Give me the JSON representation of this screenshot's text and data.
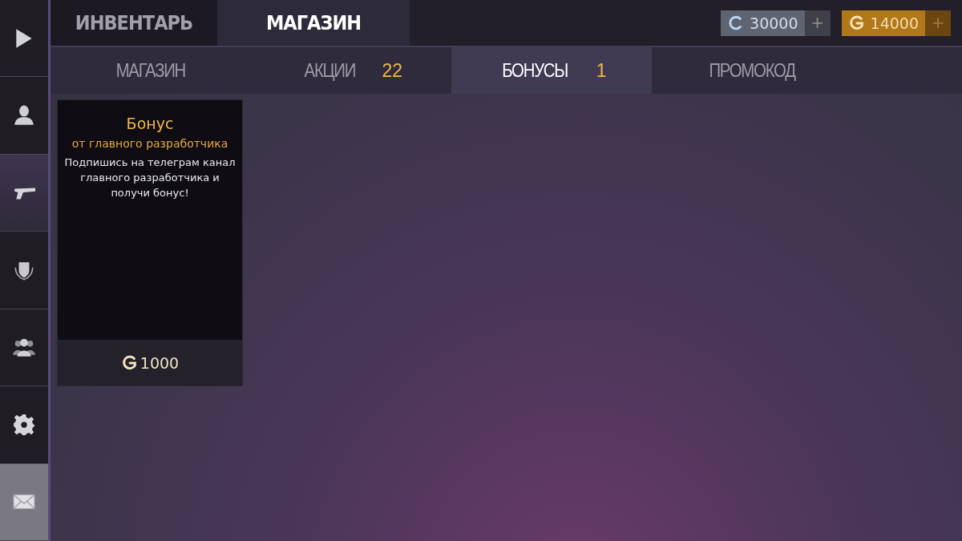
{
  "sidebar": {
    "items": [
      {
        "kind": "play",
        "selected": false
      },
      {
        "kind": "profile",
        "selected": false
      },
      {
        "kind": "pistol",
        "selected": true
      },
      {
        "kind": "shield",
        "selected": false
      },
      {
        "kind": "people",
        "selected": false
      },
      {
        "kind": "gear",
        "selected": false
      },
      {
        "kind": "mail",
        "selected": false
      }
    ]
  },
  "tabs": [
    {
      "label": "ИНВЕНТАРЬ",
      "selected": false
    },
    {
      "label": "МАГАЗИН",
      "selected": true
    }
  ],
  "currencies": [
    {
      "kind": "silver",
      "amount": "30000",
      "plus": "+"
    },
    {
      "kind": "gold",
      "amount": "14000",
      "plus": "+"
    }
  ],
  "subtabs": [
    {
      "label": "МАГАЗИН",
      "selected": false
    },
    {
      "label": "АКЦИИ",
      "count": "22",
      "selected": false
    },
    {
      "label": "БОНУСЫ",
      "count": "1",
      "selected": true
    },
    {
      "label": "ПРОМОКОД",
      "selected": false
    }
  ],
  "offers": [
    {
      "title": "Бонус",
      "subtitle": "от главного разработчика",
      "description": "Подпишись на телеграм канал главного разработчика и получи бонус!",
      "price": "1000"
    }
  ]
}
